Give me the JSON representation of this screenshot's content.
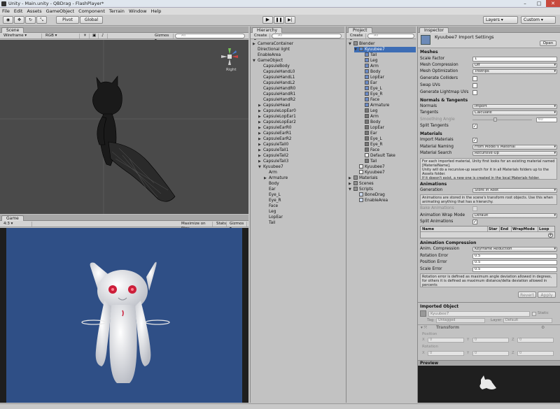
{
  "window": {
    "title": "Unity - Main.unity - QBDrag - FlashPlayer*",
    "min": "–",
    "max": "□",
    "close": "✕"
  },
  "menu": [
    "File",
    "Edit",
    "Assets",
    "GameObject",
    "Component",
    "Terrain",
    "Window",
    "Help"
  ],
  "toolbar": {
    "pivot": "Pivot",
    "global": "Global",
    "layers": "Layers",
    "layout": "Custom"
  },
  "scene": {
    "tab": "Scene",
    "shading": "Wireframe",
    "mode": "RGB",
    "gizmos": "Gizmos",
    "search": "All",
    "gizmo_label": "Right"
  },
  "game": {
    "tab": "Game",
    "aspect": "4:3",
    "maximize": "Maximize on Play",
    "stats": "Stats",
    "gizmos": "Gizmos"
  },
  "hierarchy": {
    "tab": "Hierarchy",
    "create": "Create",
    "search": "All",
    "items": [
      {
        "label": "CameraContainer",
        "indent": 0,
        "arrow": true
      },
      {
        "label": "Directional light",
        "indent": 0,
        "arrow": false
      },
      {
        "label": "EnableArea",
        "indent": 0,
        "arrow": false
      },
      {
        "label": "GameObject",
        "indent": 0,
        "arrow": true,
        "open": true
      },
      {
        "label": "CapsuleBody",
        "indent": 1,
        "arrow": false
      },
      {
        "label": "CapsuleHandL0",
        "indent": 1,
        "arrow": false
      },
      {
        "label": "CapsuleHandL1",
        "indent": 1,
        "arrow": false
      },
      {
        "label": "CapsuleHandL2",
        "indent": 1,
        "arrow": false
      },
      {
        "label": "CapsuleHandR0",
        "indent": 1,
        "arrow": false
      },
      {
        "label": "CapsuleHandR1",
        "indent": 1,
        "arrow": false
      },
      {
        "label": "CapsuleHandR2",
        "indent": 1,
        "arrow": false
      },
      {
        "label": "CapsuleHead",
        "indent": 1,
        "arrow": true
      },
      {
        "label": "CapsuleLopEar0",
        "indent": 1,
        "arrow": true
      },
      {
        "label": "CapsuleLopEar1",
        "indent": 1,
        "arrow": true
      },
      {
        "label": "CapsuleLopEar2",
        "indent": 1,
        "arrow": true
      },
      {
        "label": "CapsuleEarR0",
        "indent": 1,
        "arrow": true
      },
      {
        "label": "CapsuleEarR1",
        "indent": 1,
        "arrow": true
      },
      {
        "label": "CapsuleEarR2",
        "indent": 1,
        "arrow": true
      },
      {
        "label": "CapsuleTail0",
        "indent": 1,
        "arrow": true
      },
      {
        "label": "CapsuleTail1",
        "indent": 1,
        "arrow": true
      },
      {
        "label": "CapsuleTail2",
        "indent": 1,
        "arrow": true
      },
      {
        "label": "CapsuleTail3",
        "indent": 1,
        "arrow": true
      },
      {
        "label": "Kyuubee7",
        "indent": 1,
        "arrow": true,
        "open": true
      },
      {
        "label": "Arm",
        "indent": 2,
        "arrow": false
      },
      {
        "label": "Armature",
        "indent": 2,
        "arrow": true
      },
      {
        "label": "Body",
        "indent": 2,
        "arrow": false
      },
      {
        "label": "Ear",
        "indent": 2,
        "arrow": false
      },
      {
        "label": "Eye_L",
        "indent": 2,
        "arrow": false
      },
      {
        "label": "Eye_R",
        "indent": 2,
        "arrow": false
      },
      {
        "label": "Face",
        "indent": 2,
        "arrow": false
      },
      {
        "label": "Leg",
        "indent": 2,
        "arrow": false
      },
      {
        "label": "LopEar",
        "indent": 2,
        "arrow": false
      },
      {
        "label": "Tail",
        "indent": 2,
        "arrow": false
      }
    ]
  },
  "project": {
    "tab": "Project",
    "create": "Create",
    "search": "All",
    "items": [
      {
        "label": "Blender",
        "indent": 0,
        "icon": "folder",
        "open": true
      },
      {
        "label": "Kyuubee7",
        "indent": 1,
        "icon": "model",
        "open": true,
        "selected": true
      },
      {
        "label": "Tail",
        "indent": 2,
        "icon": "mesh"
      },
      {
        "label": "Leg",
        "indent": 2,
        "icon": "mesh"
      },
      {
        "label": "Arm",
        "indent": 2,
        "icon": "mesh"
      },
      {
        "label": "Body",
        "indent": 2,
        "icon": "mesh"
      },
      {
        "label": "LopEar",
        "indent": 2,
        "icon": "mesh"
      },
      {
        "label": "Ear",
        "indent": 2,
        "icon": "mesh"
      },
      {
        "label": "Eye_L",
        "indent": 2,
        "icon": "mesh"
      },
      {
        "label": "Eye_R",
        "indent": 2,
        "icon": "mesh"
      },
      {
        "label": "Face",
        "indent": 2,
        "icon": "mesh"
      },
      {
        "label": "Armature",
        "indent": 2,
        "icon": "mesh"
      },
      {
        "label": "Leg",
        "indent": 2,
        "icon": "grid"
      },
      {
        "label": "Arm",
        "indent": 2,
        "icon": "grid"
      },
      {
        "label": "Body",
        "indent": 2,
        "icon": "grid"
      },
      {
        "label": "LopEar",
        "indent": 2,
        "icon": "grid"
      },
      {
        "label": "Ear",
        "indent": 2,
        "icon": "grid"
      },
      {
        "label": "Eye_L",
        "indent": 2,
        "icon": "grid"
      },
      {
        "label": "Eye_R",
        "indent": 2,
        "icon": "grid"
      },
      {
        "label": "Face",
        "indent": 2,
        "icon": "grid"
      },
      {
        "label": "Default Take",
        "indent": 2,
        "icon": "doc"
      },
      {
        "label": "Tail",
        "indent": 2,
        "icon": "grid"
      },
      {
        "label": "Kyuubee7",
        "indent": 1,
        "icon": "doc"
      },
      {
        "label": "Kyuubee7",
        "indent": 1,
        "icon": "doc"
      },
      {
        "label": "Materials",
        "indent": 0,
        "icon": "folder",
        "closed": true
      },
      {
        "label": "Scenes",
        "indent": 0,
        "icon": "folder",
        "closed": true
      },
      {
        "label": "Scripts",
        "indent": 0,
        "icon": "folder",
        "open": true
      },
      {
        "label": "BoneDrag",
        "indent": 1,
        "icon": "script"
      },
      {
        "label": "EnableArea",
        "indent": 1,
        "icon": "script"
      }
    ]
  },
  "inspector": {
    "tab": "Inspector",
    "title": "Kyuubee7 Import Settings",
    "open": "Open",
    "meshes": {
      "header": "Meshes",
      "scale_factor_label": "Scale Factor",
      "scale_factor": "1",
      "mesh_compression_label": "Mesh Compression",
      "mesh_compression": "Off",
      "mesh_optimization_label": "Mesh Optimization",
      "mesh_optimization": "Tristrips",
      "gen_colliders": "Generate Colliders",
      "swap_uvs": "Swap UVs",
      "gen_lightmap": "Generate Lightmap UVs"
    },
    "normals": {
      "header": "Normals & Tangents",
      "normals_label": "Normals",
      "normals": "Import",
      "tangents_label": "Tangents",
      "tangents": "Calculate",
      "smoothing_label": "Smoothing Angle",
      "smoothing": "60",
      "split_label": "Split Tangents"
    },
    "materials": {
      "header": "Materials",
      "import_label": "Import Materials",
      "naming_label": "Material Naming",
      "naming": "From Model's Material",
      "search_label": "Material Search",
      "search": "Recursive-Up",
      "help": "For each imported material, Unity first looks for an existing material named [MaterialName].\nUnity will do a recursive-up search for it in all Materials folders up to the Assets folder.\nIf it doesn't exist, a new one is created in the local Materials folder."
    },
    "animations": {
      "header": "Animations",
      "generation_label": "Generation",
      "generation": "Store in Root",
      "help": "Animations are stored in the scene's transform root objects. Use this when animating anything that has a hierarchy.",
      "bake_label": "Bake Animations",
      "wrap_label": "Animation Wrap Mode",
      "wrap": "Default",
      "split_label": "Split Animations",
      "cols": [
        "Name",
        "Star",
        "End",
        "WrapMode",
        "Loop"
      ]
    },
    "compression": {
      "header": "Animation Compression",
      "anim_label": "Anim. Compression",
      "anim": "Keyframe Reduction",
      "rot_label": "Rotation Error",
      "rot": "0.5",
      "pos_label": "Position Error",
      "pos": "0.5",
      "scale_label": "Scale Error",
      "scale": "0.5",
      "help": "Rotation error is defined as maximum angle deviation allowed in degrees, for others it is defined as maximum distance/delta deviation allowed in percents"
    },
    "revert": "Revert",
    "apply": "Apply",
    "imported": {
      "header": "Imported Object",
      "name": "Kyuubee7",
      "static": "Static",
      "tag_label": "Tag",
      "tag": "Untagged",
      "layer_label": "Layer",
      "layer": "Default",
      "transform": "Transform",
      "position": "Position",
      "rotation": "Rotation",
      "x": "X",
      "y": "Y",
      "z": "Z",
      "zero": "0"
    },
    "preview": "Preview"
  },
  "colors": {
    "game_bg": "#2f4f86",
    "scene_bg": "#4a4a4a",
    "selection": "#3d6db5"
  }
}
